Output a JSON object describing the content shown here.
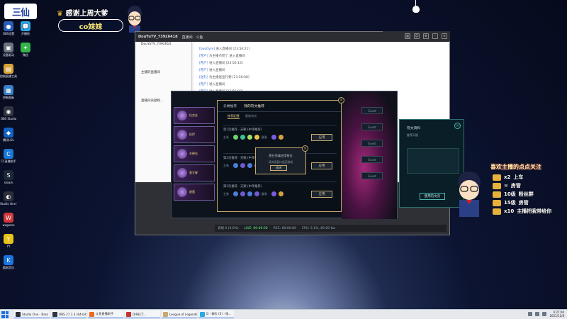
{
  "overlay": {
    "brand": "三仙",
    "thanks": "感谢上周大爹",
    "thanks_crown": "♛",
    "name": "co妹妹"
  },
  "desktop_icons_col1": [
    {
      "name": "obs-like",
      "label": "OBS设置",
      "color": "#2a5eb8",
      "glyph": "●"
    },
    {
      "name": "app-2",
      "label": "设备驱动",
      "color": "#6a7280",
      "glyph": "▣"
    },
    {
      "name": "folder",
      "label": "控制直播工具",
      "color": "#d9a23a",
      "glyph": "▤"
    },
    {
      "name": "control",
      "label": "控制面板",
      "color": "#3a7fc6",
      "glyph": "▦"
    },
    {
      "name": "obs-studio",
      "label": "OBS Studio",
      "color": "#303642",
      "glyph": "◉"
    },
    {
      "name": "app-6",
      "label": "腾讯LOL",
      "color": "#1462c4",
      "glyph": "◆"
    },
    {
      "name": "app-7",
      "label": "CC直播助手",
      "color": "#1b76d4",
      "glyph": "C"
    },
    {
      "name": "steam",
      "label": "steam",
      "color": "#1b2838",
      "glyph": "S"
    },
    {
      "name": "studio-one",
      "label": "Studio One 5",
      "color": "#2a2f3a",
      "glyph": "◐"
    },
    {
      "name": "wegame",
      "label": "wegame",
      "color": "#d2373a",
      "glyph": "W"
    },
    {
      "name": "yy",
      "label": "YY",
      "color": "#e8c21a",
      "glyph": "Y"
    },
    {
      "name": "kugou",
      "label": "酷狗音乐",
      "color": "#1a74dd",
      "glyph": "K"
    }
  ],
  "desktop_icons_col2": [
    {
      "name": "chat-app",
      "label": "开播啦",
      "color": "#2aa8e8",
      "glyph": "💬"
    },
    {
      "name": "wechat",
      "label": "微信",
      "color": "#36b44a",
      "glyph": "✦"
    }
  ],
  "main_window": {
    "title": "DouYuTV_73926418",
    "title_extra": "直播间 · 斗鱼",
    "left_rows": [
      "DouYuTV_7392614",
      "",
      "",
      "",
      "",
      "主播的直播间",
      "",
      "",
      "",
      "",
      "直播间贡献榜...",
      "",
      "",
      "",
      "",
      "",
      "",
      "",
      ""
    ],
    "messages": [
      {
        "user": "[bootlyre]",
        "text": "进入直播间 [23:56:21]"
      },
      {
        "user": "[用户]",
        "text": "为主播点赞了 进入直播间"
      },
      {
        "user": "[用户]",
        "text": "进入直播间 [23:56:13]"
      },
      {
        "user": "[用户]",
        "text": "进入直播间"
      },
      {
        "user": "[送礼]",
        "text": "为主播送出礼物 [23:56:08]"
      },
      {
        "user": "[用户]",
        "text": "进入直播间"
      },
      {
        "user": "[用户]",
        "text": "进入直播间 [23:56:03]"
      },
      {
        "user": "[用户]",
        "text": "为主播点赞了"
      }
    ],
    "obs_bar": {
      "a": "丢帧 0 (0.0%)",
      "b": "LIVE: 00:00:00",
      "c": "REC: 00:00:00",
      "d": "CPU: 5.1%, 60.00 fps"
    }
  },
  "league": {
    "champions": [
      {
        "label": "拉克丝"
      },
      {
        "label": "佐伊"
      },
      {
        "label": "辛德拉"
      },
      {
        "label": "莫甘娜"
      },
      {
        "label": "妮蔻"
      }
    ],
    "slots": [
      "Guest",
      "Guest",
      "Guest",
      "Guest",
      "Guest"
    ]
  },
  "runes": {
    "tabs": [
      {
        "label": "云端推荐",
        "selected": false
      },
      {
        "label": "我的符文推荐",
        "selected": true
      }
    ],
    "subtabs": [
      {
        "label": "推荐配置",
        "selected": true
      },
      {
        "label": "我的符文",
        "selected": false
      }
    ],
    "pages": [
      {
        "title": "第1页推荐 · 天赋 (中单推荐)",
        "label_left": "主系",
        "label_right": "副系",
        "button": "应用"
      },
      {
        "title": "第2页推荐 · 天赋 (中单推荐)",
        "label_left": "主系",
        "label_right": "副系",
        "button": "应用"
      },
      {
        "title": "第3页推荐 · 天赋 (中单推荐)",
        "label_left": "主系",
        "label_right": "副系",
        "button": "应用"
      }
    ],
    "popup": {
      "title": "您已完成应用符文",
      "sub": "请关闭窗口返回游戏",
      "button": "关闭"
    }
  },
  "side_panel": {
    "title": "符文资料",
    "sub": "推荐天赋",
    "button": "使用符文页"
  },
  "follow": {
    "title": "喜欢主播的点点关注",
    "rows": [
      {
        "mult": "x2",
        "text": "上车"
      },
      {
        "mult": "=",
        "text": "房管"
      },
      {
        "mult": "10级",
        "text": "粉丝群"
      },
      {
        "mult": "15级",
        "text": "房管"
      },
      {
        "mult": "x10",
        "text": "主播把我带给你"
      }
    ]
  },
  "taskbar": {
    "tasks": [
      {
        "label": "Studio One - Bass",
        "color": "#2a2f3a"
      },
      {
        "label": "OBS 27.1.3 (64-bit)",
        "color": "#303642"
      },
      {
        "label": "斗鱼直播助手",
        "color": "#f06a1f"
      },
      {
        "label": "DIRECT...",
        "color": "#c2362f"
      },
      {
        "label": "League of Legends",
        "color": "#c8aa6e"
      },
      {
        "label": "Q - 聊天 (5) - 版...",
        "color": "#2aa8e8"
      }
    ],
    "clock_time": "0:27:00",
    "clock_date": "2021/11/8"
  },
  "colors": {
    "accent_gold": "#c8aa6e",
    "teal": "#4fb6b1",
    "live_green": "#62ff82"
  }
}
